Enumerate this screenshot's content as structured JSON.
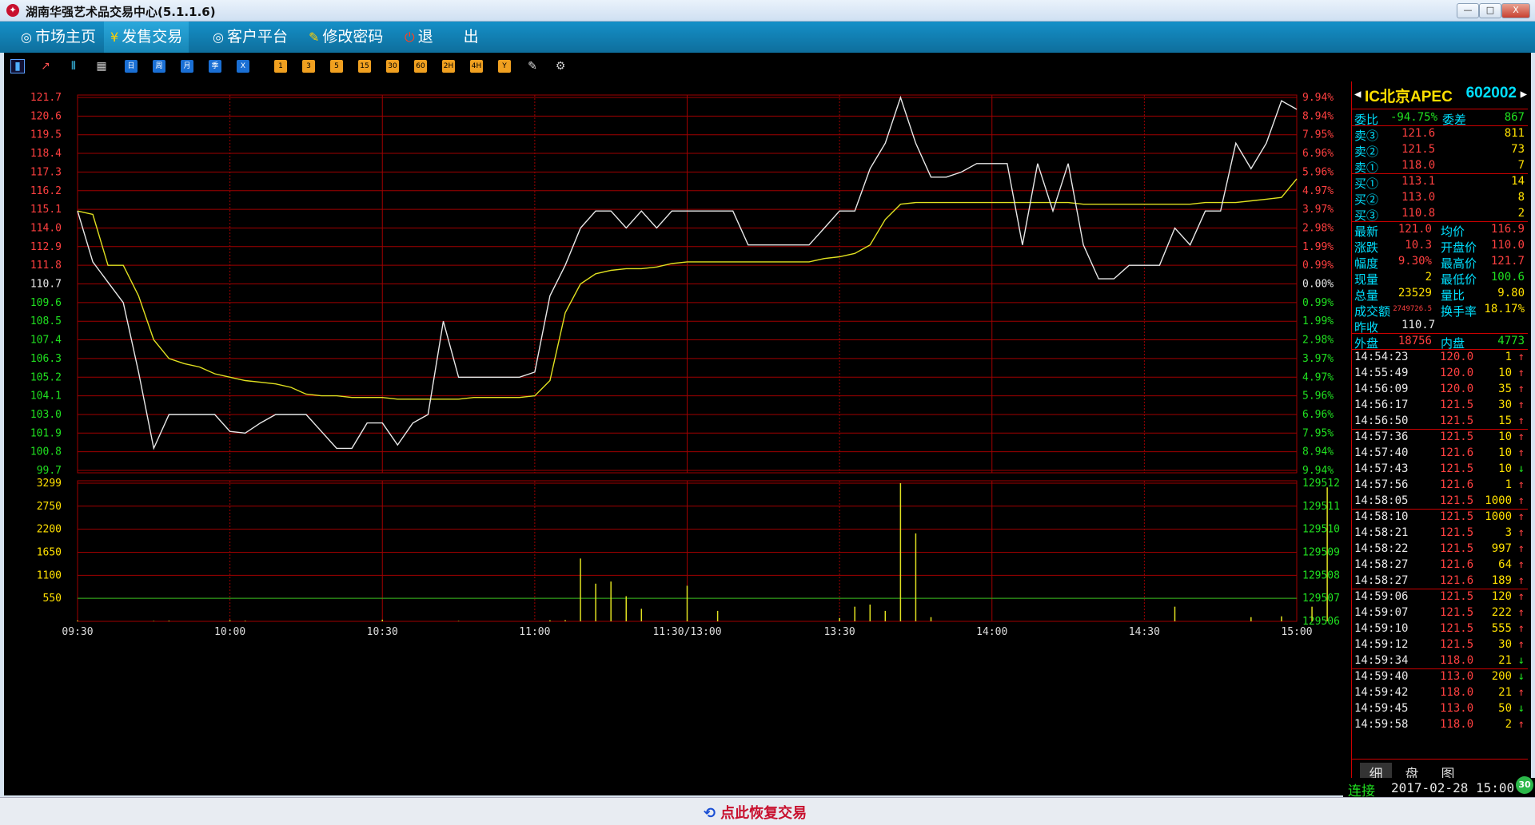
{
  "window": {
    "title": "湖南华强艺术品交易中心(5.1.1.6)",
    "min": "—",
    "max": "□",
    "close": "X"
  },
  "menu": [
    {
      "icon": "◎",
      "label": "市场主页"
    },
    {
      "icon": "¥",
      "label": "发售交易"
    },
    {
      "icon": "◎",
      "label": "客户平台"
    },
    {
      "icon": "✎",
      "label": "修改密码"
    },
    {
      "icon": "⏻",
      "label": "退　　出"
    }
  ],
  "toolbar": {
    "periods": [
      "日",
      "周",
      "月",
      "季",
      "X"
    ],
    "minutes": [
      "1",
      "3",
      "5",
      "15",
      "30",
      "60",
      "2H",
      "4H",
      "Y"
    ]
  },
  "price_axis": {
    "left": [
      "121.7",
      "120.6",
      "119.5",
      "118.4",
      "117.3",
      "116.2",
      "115.1",
      "114.0",
      "112.9",
      "111.8",
      "110.7",
      "109.6",
      "108.5",
      "107.4",
      "106.3",
      "105.2",
      "104.1",
      "103.0",
      "101.9",
      "100.8",
      "99.7"
    ],
    "right": [
      "9.94%",
      "8.94%",
      "7.95%",
      "6.96%",
      "5.96%",
      "4.97%",
      "3.97%",
      "2.98%",
      "1.99%",
      "0.99%",
      "0.00%",
      "0.99%",
      "1.99%",
      "2.98%",
      "3.97%",
      "4.97%",
      "5.96%",
      "6.96%",
      "7.95%",
      "8.94%",
      "9.94%"
    ]
  },
  "volume_axis": {
    "left": [
      "3299",
      "2750",
      "2200",
      "1650",
      "1100",
      "550"
    ],
    "right": [
      "129512",
      "129511",
      "129510",
      "129509",
      "129508",
      "129507",
      "129506"
    ]
  },
  "time_axis": [
    "09:30",
    "10:00",
    "10:30",
    "11:00",
    "11:30/13:00",
    "13:30",
    "14:00",
    "14:30",
    "15:00"
  ],
  "colors": {
    "price_line": "#e8e8e8",
    "avg_line": "#e0e020",
    "grid": "#a00000",
    "up": "#ff4040",
    "down": "#20e020",
    "volume": "#e0e020",
    "ref_line": "#20c020"
  },
  "chart_data": {
    "type": "line",
    "title": "",
    "prev_close": 110.7,
    "ylim": [
      99.7,
      121.7
    ],
    "x": [
      "09:30",
      "09:33",
      "09:36",
      "09:39",
      "09:42",
      "09:45",
      "09:48",
      "09:51",
      "09:54",
      "09:57",
      "10:00",
      "10:03",
      "10:06",
      "10:09",
      "10:12",
      "10:15",
      "10:18",
      "10:21",
      "10:24",
      "10:27",
      "10:30",
      "10:33",
      "10:36",
      "10:39",
      "10:42",
      "10:45",
      "10:48",
      "10:51",
      "10:54",
      "10:57",
      "11:00",
      "11:03",
      "11:06",
      "11:09",
      "11:12",
      "11:15",
      "11:18",
      "11:21",
      "11:24",
      "11:27",
      "11:30/13:00",
      "13:03",
      "13:06",
      "13:09",
      "13:12",
      "13:15",
      "13:18",
      "13:21",
      "13:24",
      "13:27",
      "13:30",
      "13:33",
      "13:36",
      "13:39",
      "13:42",
      "13:45",
      "13:48",
      "13:51",
      "13:54",
      "13:57",
      "14:00",
      "14:03",
      "14:06",
      "14:09",
      "14:12",
      "14:15",
      "14:18",
      "14:21",
      "14:24",
      "14:27",
      "14:30",
      "14:33",
      "14:36",
      "14:39",
      "14:42",
      "14:45",
      "14:48",
      "14:51",
      "14:54",
      "14:57",
      "15:00"
    ],
    "series": [
      {
        "name": "",
        "values": [
          115.0,
          112.0,
          110.8,
          109.6,
          105.5,
          101.0,
          103.0,
          103.0,
          103.0,
          103.0,
          102.0,
          101.9,
          102.5,
          103.0,
          103.0,
          103.0,
          102.0,
          101.0,
          101.0,
          102.5,
          102.5,
          101.2,
          102.5,
          103.0,
          108.5,
          105.2,
          105.2,
          105.2,
          105.2,
          105.2,
          105.5,
          110.0,
          111.8,
          114.0,
          115.0,
          115.0,
          114.0,
          115.0,
          114.0,
          115.0,
          115.0,
          115.0,
          115.0,
          115.0,
          113.0,
          113.0,
          113.0,
          113.0,
          113.0,
          114.0,
          115.0,
          115.0,
          117.5,
          119.0,
          121.7,
          119.0,
          117.0,
          117.0,
          117.3,
          117.8,
          117.8,
          117.8,
          113.0,
          117.8,
          115.0,
          117.8,
          113.0,
          111.0,
          111.0,
          111.8,
          111.8,
          111.8,
          114.0,
          113.0,
          115.0,
          115.0,
          119.0,
          117.5,
          119.0,
          121.5,
          121.0
        ]
      },
      {
        "name": "",
        "values": [
          115.0,
          114.8,
          111.8,
          111.8,
          110.0,
          107.4,
          106.3,
          106.0,
          105.8,
          105.4,
          105.2,
          105.0,
          104.9,
          104.8,
          104.6,
          104.2,
          104.1,
          104.1,
          104.0,
          104.0,
          104.0,
          103.9,
          103.9,
          103.9,
          103.9,
          103.9,
          104.0,
          104.0,
          104.0,
          104.0,
          104.1,
          105.0,
          109.0,
          110.7,
          111.3,
          111.5,
          111.6,
          111.6,
          111.7,
          111.9,
          112.0,
          112.0,
          112.0,
          112.0,
          112.0,
          112.0,
          112.0,
          112.0,
          112.0,
          112.2,
          112.3,
          112.5,
          113.0,
          114.5,
          115.4,
          115.5,
          115.5,
          115.5,
          115.5,
          115.5,
          115.5,
          115.5,
          115.5,
          115.5,
          115.5,
          115.5,
          115.4,
          115.4,
          115.4,
          115.4,
          115.4,
          115.4,
          115.4,
          115.4,
          115.5,
          115.5,
          115.5,
          115.6,
          115.7,
          115.8,
          116.9
        ]
      }
    ],
    "volume": {
      "ylim": [
        0,
        3299
      ],
      "ref_line": 550,
      "values": [
        20,
        0,
        0,
        0,
        0,
        10,
        15,
        0,
        0,
        0,
        30,
        15,
        0,
        0,
        0,
        0,
        0,
        0,
        0,
        0,
        40,
        0,
        0,
        0,
        0,
        10,
        0,
        0,
        0,
        0,
        0,
        25,
        30,
        1500,
        900,
        950,
        600,
        300,
        0,
        0,
        850,
        0,
        250,
        0,
        0,
        0,
        0,
        0,
        0,
        0,
        80,
        350,
        400,
        250,
        3299,
        2100,
        100,
        0,
        0,
        0,
        0,
        0,
        0,
        0,
        0,
        0,
        0,
        0,
        0,
        0,
        0,
        0,
        350,
        0,
        0,
        0,
        0,
        100,
        0,
        120,
        0,
        350,
        3200
      ]
    }
  },
  "quote": {
    "name": "IC北京APEC",
    "code": "602002",
    "weibi": {
      "label": "委比",
      "value": "-94.75%"
    },
    "weicha": {
      "label": "委差",
      "value": "867"
    },
    "asks": [
      {
        "label": "卖③",
        "price": "121.6",
        "qty": "811"
      },
      {
        "label": "卖②",
        "price": "121.5",
        "qty": "73"
      },
      {
        "label": "卖①",
        "price": "118.0",
        "qty": "7"
      }
    ],
    "bids": [
      {
        "label": "买①",
        "price": "113.1",
        "qty": "14"
      },
      {
        "label": "买②",
        "price": "113.0",
        "qty": "8"
      },
      {
        "label": "买③",
        "price": "110.8",
        "qty": "2"
      }
    ],
    "stats": [
      {
        "l1": "最新",
        "v1": "121.0",
        "l2": "均价",
        "v2": "116.9"
      },
      {
        "l1": "涨跌",
        "v1": "10.3",
        "l2": "开盘价",
        "v2": "110.0"
      },
      {
        "l1": "幅度",
        "v1": "9.30%",
        "l2": "最高价",
        "v2": "121.7"
      },
      {
        "l1": "现量",
        "v1": "2",
        "l2": "最低价",
        "v2": "100.6"
      },
      {
        "l1": "总量",
        "v1": "23529",
        "l2": "量比",
        "v2": "9.80"
      },
      {
        "l1": "成交额",
        "v1": "2749726.5",
        "l2": "换手率",
        "v2": "18.17%"
      }
    ],
    "prev": {
      "label": "昨收",
      "value": "110.7"
    },
    "outer": {
      "label": "外盘",
      "value": "18756"
    },
    "inner": {
      "label": "内盘",
      "value": "4773"
    },
    "ticks": [
      {
        "t": "14:54:23",
        "p": "120.0",
        "q": "1",
        "d": "up"
      },
      {
        "t": "14:55:49",
        "p": "120.0",
        "q": "10",
        "d": "up"
      },
      {
        "t": "14:56:09",
        "p": "120.0",
        "q": "35",
        "d": "up"
      },
      {
        "t": "14:56:17",
        "p": "121.5",
        "q": "30",
        "d": "up"
      },
      {
        "t": "14:56:50",
        "p": "121.5",
        "q": "15",
        "d": "up"
      },
      {
        "t": "14:57:36",
        "p": "121.5",
        "q": "10",
        "d": "up"
      },
      {
        "t": "14:57:40",
        "p": "121.6",
        "q": "10",
        "d": "up"
      },
      {
        "t": "14:57:43",
        "p": "121.5",
        "q": "10",
        "d": "down"
      },
      {
        "t": "14:57:56",
        "p": "121.6",
        "q": "1",
        "d": "up"
      },
      {
        "t": "14:58:05",
        "p": "121.5",
        "q": "1000",
        "d": "up"
      },
      {
        "t": "14:58:10",
        "p": "121.5",
        "q": "1000",
        "d": "up"
      },
      {
        "t": "14:58:21",
        "p": "121.5",
        "q": "3",
        "d": "up"
      },
      {
        "t": "14:58:22",
        "p": "121.5",
        "q": "997",
        "d": "up"
      },
      {
        "t": "14:58:27",
        "p": "121.6",
        "q": "64",
        "d": "up"
      },
      {
        "t": "14:58:27",
        "p": "121.6",
        "q": "189",
        "d": "up"
      },
      {
        "t": "14:59:06",
        "p": "121.5",
        "q": "120",
        "d": "up"
      },
      {
        "t": "14:59:07",
        "p": "121.5",
        "q": "222",
        "d": "up"
      },
      {
        "t": "14:59:10",
        "p": "121.5",
        "q": "555",
        "d": "up"
      },
      {
        "t": "14:59:12",
        "p": "121.5",
        "q": "30",
        "d": "up"
      },
      {
        "t": "14:59:34",
        "p": "118.0",
        "q": "21",
        "d": "down"
      },
      {
        "t": "14:59:40",
        "p": "113.0",
        "q": "200",
        "d": "down"
      },
      {
        "t": "14:59:42",
        "p": "118.0",
        "q": "21",
        "d": "up"
      },
      {
        "t": "14:59:45",
        "p": "113.0",
        "q": "50",
        "d": "down"
      },
      {
        "t": "14:59:58",
        "p": "118.0",
        "q": "2",
        "d": "up"
      }
    ],
    "tabs": [
      "细",
      "盘",
      "图"
    ]
  },
  "status": {
    "connection": "连接",
    "datetime": "2017-02-28 15:00",
    "badge": "30"
  },
  "bottom": {
    "restore_label": "点此恢复交易"
  }
}
